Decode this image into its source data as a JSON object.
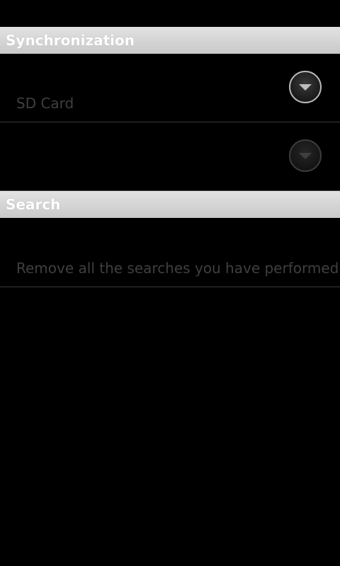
{
  "sync": {
    "header": "Synchronization",
    "storage": {
      "title": "",
      "summary": "SD Card",
      "button_icon": "chevron-down-icon"
    },
    "second": {
      "title": "",
      "summary": "",
      "button_icon": "chevron-down-icon"
    }
  },
  "search": {
    "header": "Search",
    "clear": {
      "title": "",
      "summary": "Remove all the searches you have performed"
    }
  }
}
